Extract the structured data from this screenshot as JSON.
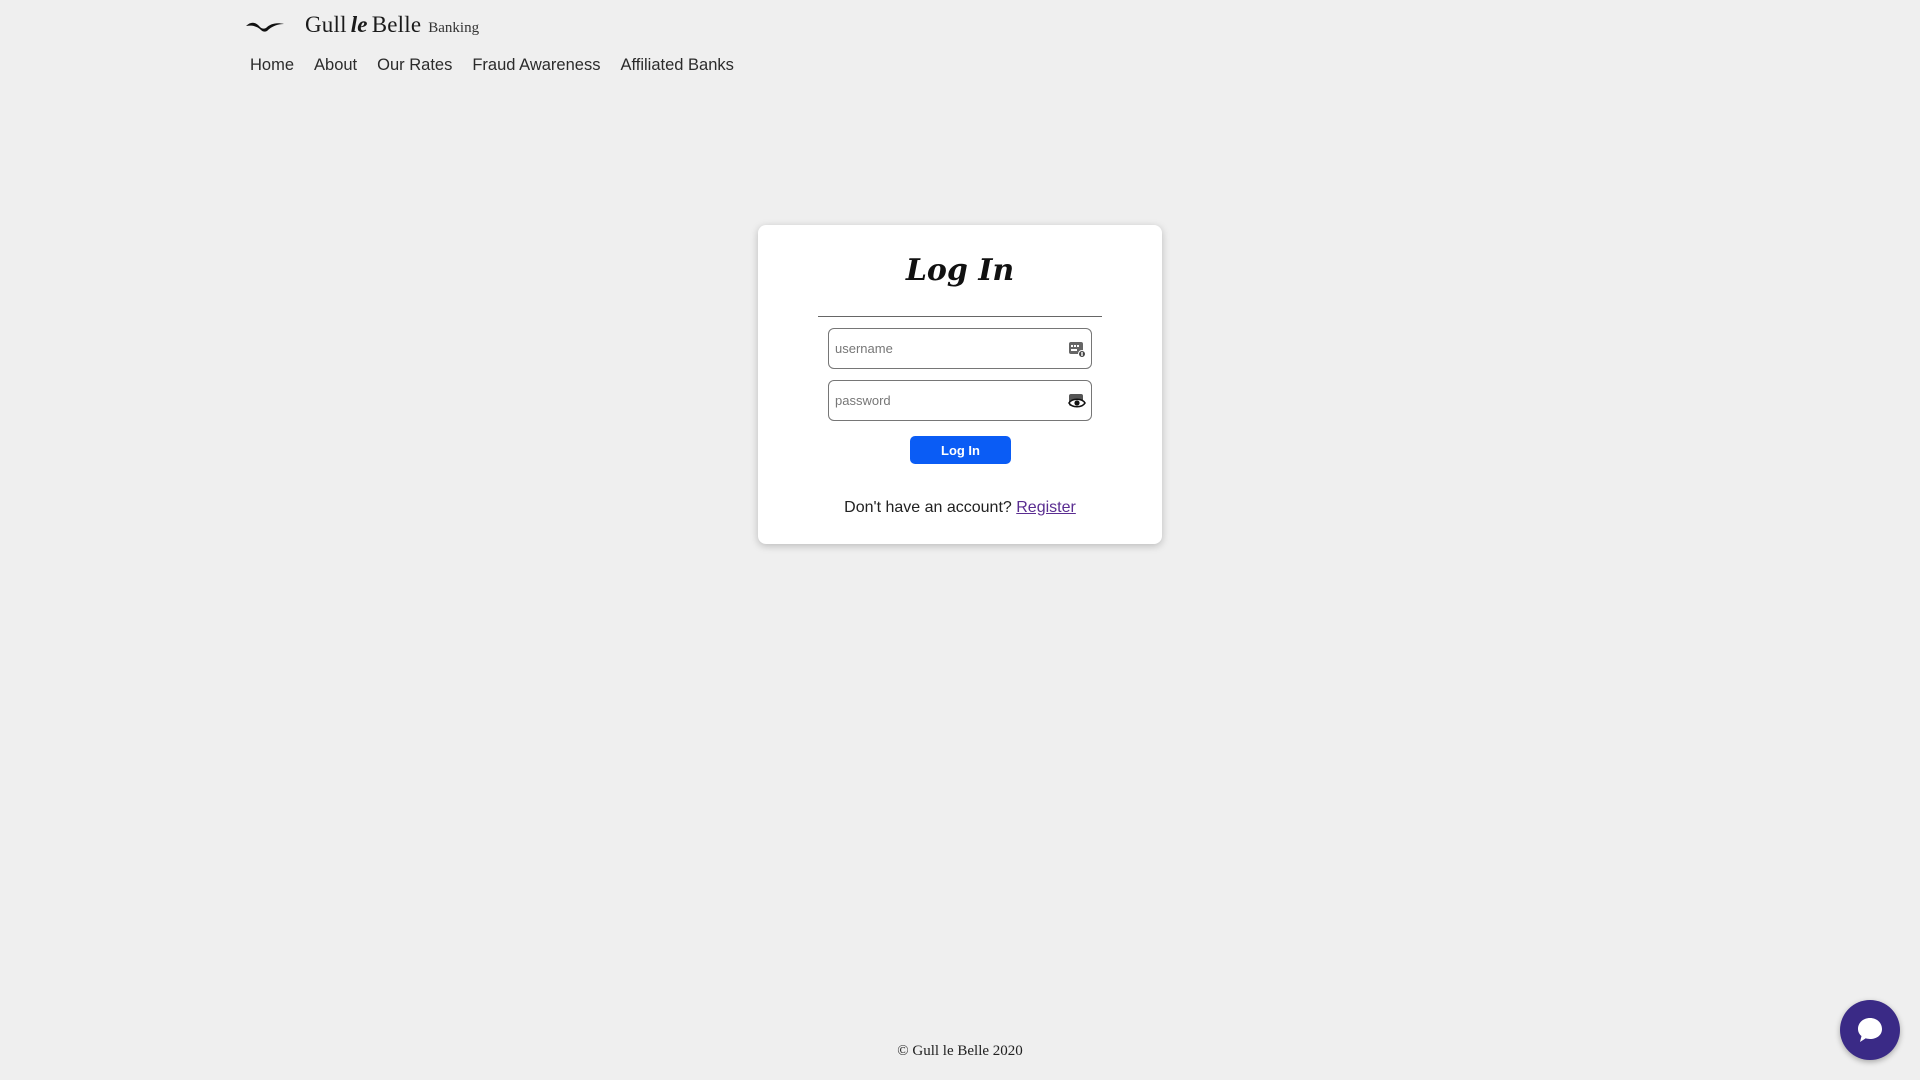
{
  "header": {
    "brand_first": "Gull",
    "brand_mid": "le",
    "brand_last": "Belle",
    "brand_sub": "Banking",
    "logo_icon": "gull-logo-icon"
  },
  "nav": {
    "items": [
      {
        "label": "Home"
      },
      {
        "label": "About"
      },
      {
        "label": "Our Rates"
      },
      {
        "label": "Fraud Awareness"
      },
      {
        "label": "Affiliated Banks"
      }
    ]
  },
  "login": {
    "title": "Log In",
    "username_placeholder": "username",
    "username_value": "",
    "username_icon": "autofill-card-icon",
    "password_placeholder": "password",
    "password_value": "",
    "password_icon": "eye-icon",
    "button_label": "Log In",
    "register_prompt": "Don't have an account?",
    "register_link": "Register"
  },
  "footer": {
    "copyright": "© Gull le Belle 2020"
  },
  "chat": {
    "icon": "chat-bubble-icon"
  },
  "colors": {
    "page_bg": "#efefef",
    "button_bg": "#0a5cf5",
    "link": "#5a2d91",
    "chat_bg": "#3a2a86"
  }
}
